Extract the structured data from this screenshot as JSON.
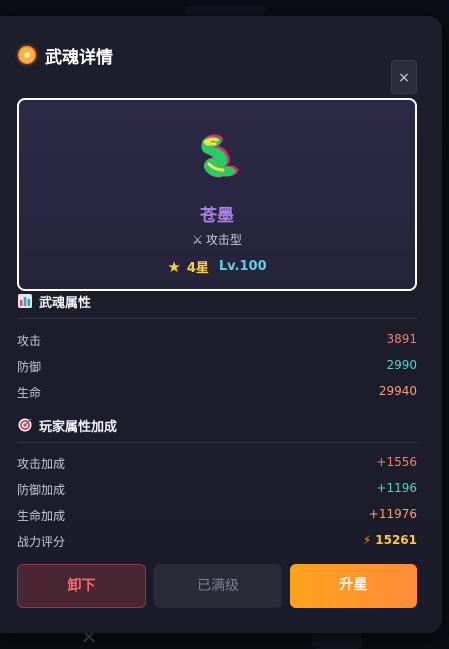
{
  "modal": {
    "title": "武魂详情",
    "close_label": "×"
  },
  "hero": {
    "name": "苍墨",
    "type_label": "攻击型",
    "stars": "4星",
    "level": "Lv.100"
  },
  "spirit_stats": {
    "title": "武魂属性",
    "rows": [
      {
        "label": "攻击",
        "value": "3891"
      },
      {
        "label": "防御",
        "value": "2990"
      },
      {
        "label": "生命",
        "value": "29940"
      }
    ]
  },
  "player_bonus": {
    "title": "玩家属性加成",
    "rows": [
      {
        "label": "攻击加成",
        "value": "+1556"
      },
      {
        "label": "防御加成",
        "value": "+1196"
      },
      {
        "label": "生命加成",
        "value": "+11976"
      },
      {
        "label": "战力评分",
        "value": "15261"
      }
    ]
  },
  "actions": {
    "unequip": "卸下",
    "maxed": "已满级",
    "star_up": "升星"
  },
  "colors": {
    "accent_orange": "#ffa21a",
    "name_purple": "#a982e3",
    "star_gold": "#ffd33d",
    "level_cyan": "#5fd0e3",
    "danger_red": "#ff6b6b"
  },
  "icons": {
    "title": "sun-flower-icon",
    "close": "close-icon",
    "hero": "dragon-icon",
    "type": "crossed-swords-icon",
    "star": "star-icon",
    "spirit_section": "bar-chart-icon",
    "bonus_section": "target-icon",
    "power": "lightning-icon"
  }
}
